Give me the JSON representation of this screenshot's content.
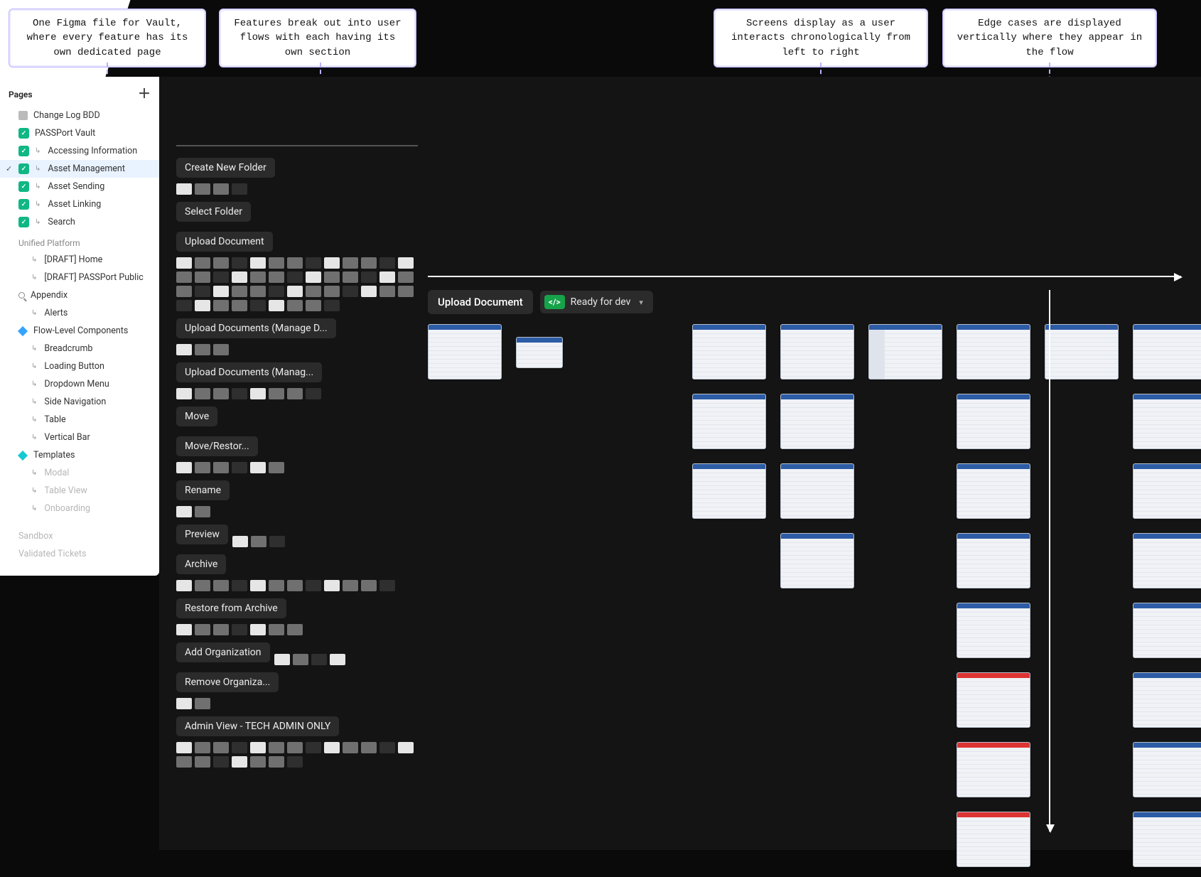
{
  "callouts": {
    "c1": "One Figma file for Vault, where every feature has its own dedicated page",
    "c2": "Features break out into user flows with each having its own section",
    "c3": "Screens display as a user interacts chronologically from left to right",
    "c4": "Edge cases are displayed vertically where they appear in the flow"
  },
  "sidebar": {
    "header": "Pages",
    "items": [
      {
        "label": "Change Log BDD",
        "icon": "doc"
      },
      {
        "label": "PASSPort Vault",
        "icon": "green"
      },
      {
        "label": "Accessing Information",
        "icon": "green",
        "nest": true
      },
      {
        "label": "Asset Management",
        "icon": "green",
        "nest": true,
        "selected": true
      },
      {
        "label": "Asset Sending",
        "icon": "green",
        "nest": true
      },
      {
        "label": "Asset Linking",
        "icon": "green",
        "nest": true
      },
      {
        "label": "Search",
        "icon": "green",
        "nest": true
      }
    ],
    "groups": [
      {
        "title": "Unified Platform",
        "items": [
          {
            "label": "[DRAFT] Home",
            "nest": true
          },
          {
            "label": "[DRAFT] PASSPort Public",
            "nest": true
          }
        ]
      },
      {
        "title": "Appendix",
        "icon": "search",
        "items": [
          {
            "label": "Alerts",
            "nest": true
          }
        ]
      },
      {
        "title": "Flow-Level Components",
        "icon": "diamond-blue",
        "items": [
          {
            "label": "Breadcrumb",
            "nest": true
          },
          {
            "label": "Loading Button",
            "nest": true
          },
          {
            "label": "Dropdown Menu",
            "nest": true
          },
          {
            "label": "Side Navigation",
            "nest": true
          },
          {
            "label": "Table",
            "nest": true
          },
          {
            "label": "Vertical Bar",
            "nest": true
          }
        ]
      },
      {
        "title": "Templates",
        "icon": "diamond-cyan",
        "items": [
          {
            "label": "Modal",
            "nest": true
          },
          {
            "label": "Table View",
            "nest": true
          },
          {
            "label": "Onboarding",
            "nest": true
          }
        ]
      }
    ],
    "dimmed": [
      "Sandbox",
      "Validated Tickets"
    ]
  },
  "flows": {
    "sections": [
      {
        "label": "Create New Folder",
        "thumbs": 4
      },
      {
        "label": "Select Folder",
        "thumbs": 0
      },
      {
        "label": "Upload Document",
        "thumbs": 48
      },
      {
        "label": "Upload Documents (Manage D...",
        "thumbs": 3
      },
      {
        "label": "Upload Documents (Manag...",
        "thumbs": 8
      },
      {
        "label": "Move",
        "thumbs": 0
      },
      {
        "label": "Move/Restor...",
        "thumbs": 6
      },
      {
        "label": "Rename",
        "thumbs": 2
      },
      {
        "label": "Preview",
        "thumbs": 3,
        "inline": true
      },
      {
        "label": "Archive",
        "thumbs": 12
      },
      {
        "label": "Restore from Archive",
        "thumbs": 7
      },
      {
        "label": "Add Organization",
        "thumbs": 4,
        "inline": true
      },
      {
        "label": "Remove Organiza...",
        "thumbs": 2
      },
      {
        "label": "Admin View - TECH ADMIN ONLY",
        "thumbs": 20
      }
    ]
  },
  "detail": {
    "title": "Upload Document",
    "status_label": "Ready for dev",
    "status_glyph": "</>",
    "grid": [
      [
        1,
        2,
        0,
        3,
        3,
        4,
        3,
        3,
        3,
        3
      ],
      [
        0,
        0,
        0,
        3,
        3,
        0,
        3,
        0,
        3,
        0
      ],
      [
        0,
        0,
        0,
        3,
        3,
        0,
        3,
        0,
        3,
        0
      ],
      [
        0,
        0,
        0,
        0,
        3,
        0,
        3,
        0,
        3,
        0
      ],
      [
        0,
        0,
        0,
        0,
        0,
        0,
        3,
        0,
        3,
        0
      ],
      [
        0,
        0,
        0,
        0,
        0,
        0,
        3,
        0,
        3,
        0
      ],
      [
        0,
        0,
        0,
        0,
        0,
        0,
        3,
        0,
        3,
        0
      ],
      [
        0,
        0,
        0,
        0,
        0,
        0,
        3,
        0,
        3,
        0
      ]
    ]
  }
}
